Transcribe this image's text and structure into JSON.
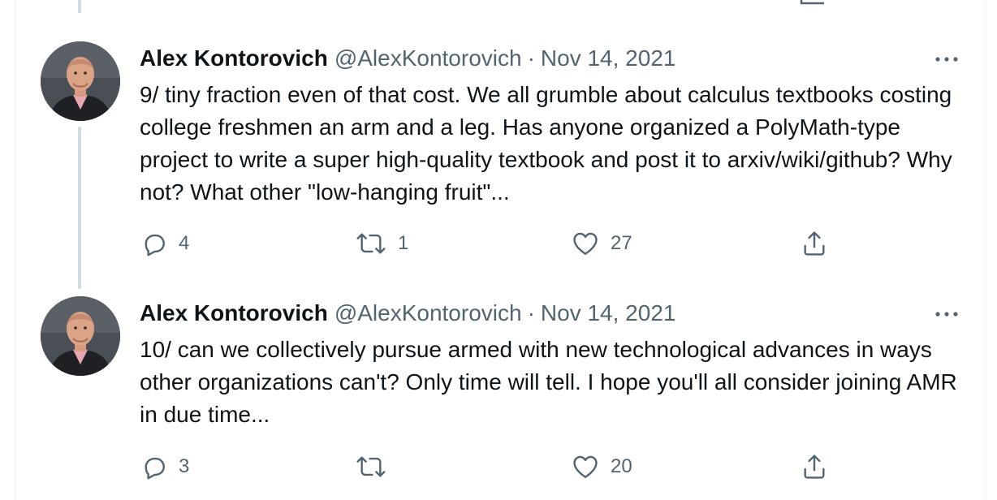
{
  "tweets": [
    {
      "author_name": "Alex Kontorovich",
      "handle": "@AlexKontorovich",
      "separator": "·",
      "date": "Nov 14, 2021",
      "text": "9/ tiny fraction even of that cost. We all grumble about calculus textbooks costing college freshmen an arm and a leg. Has anyone organized a PolyMath-type project to write a super high-quality textbook and post it to arxiv/wiki/github? Why not? What other \"low-hanging fruit\"...",
      "replies": "4",
      "retweets": "1",
      "likes": "27"
    },
    {
      "author_name": "Alex Kontorovich",
      "handle": "@AlexKontorovich",
      "separator": "·",
      "date": "Nov 14, 2021",
      "text": "10/ can we collectively pursue armed with new technological advances in ways other organizations can't? Only time will tell. I hope you'll all consider joining AMR in due time...",
      "replies": "3",
      "retweets": "",
      "likes": "20"
    }
  ],
  "icons": {
    "reply": "reply-icon",
    "retweet": "retweet-icon",
    "like": "heart-icon",
    "share": "share-icon",
    "more": "more-dots-icon"
  },
  "colors": {
    "text": "#0f1419",
    "secondary": "#536471",
    "thread_line": "#cfd9de"
  }
}
